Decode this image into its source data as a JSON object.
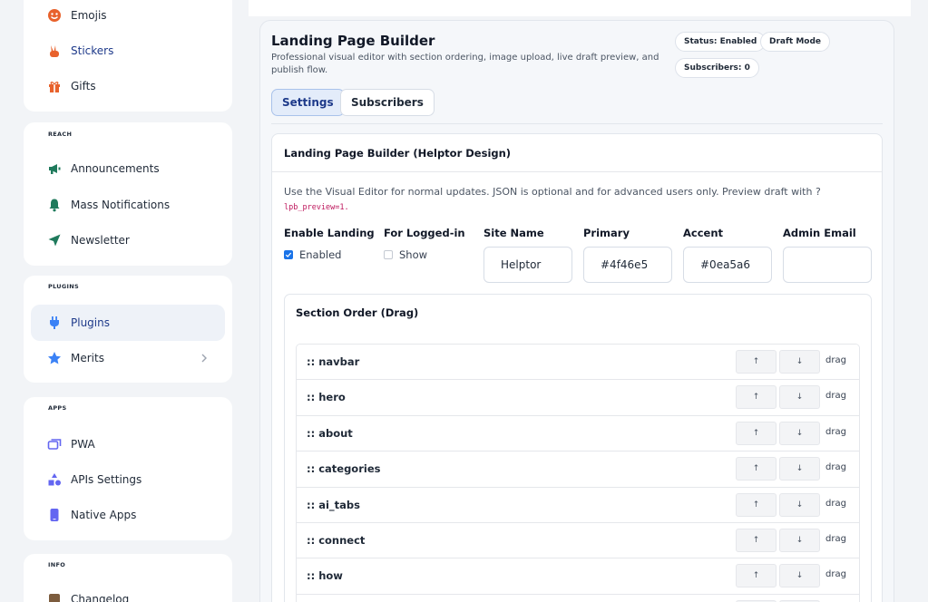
{
  "sidebar": {
    "sections": [
      {
        "title": "",
        "items": [
          {
            "label": "Emojis",
            "icon": "emoji-icon",
            "active": false
          },
          {
            "label": "Stickers",
            "icon": "sticker-icon",
            "active": false
          },
          {
            "label": "Gifts",
            "icon": "gift-icon",
            "active": false
          }
        ]
      },
      {
        "title": "REACH",
        "items": [
          {
            "label": "Announcements",
            "icon": "megaphone-icon"
          },
          {
            "label": "Mass Notifications",
            "icon": "bell-icon"
          },
          {
            "label": "Newsletter",
            "icon": "send-icon"
          }
        ]
      },
      {
        "title": "PLUGINS",
        "items": [
          {
            "label": "Plugins",
            "icon": "plug-icon",
            "active": true
          },
          {
            "label": "Merits",
            "icon": "star-icon",
            "expandable": true
          }
        ]
      },
      {
        "title": "APPS",
        "items": [
          {
            "label": "PWA",
            "icon": "windows-icon"
          },
          {
            "label": "APIs Settings",
            "icon": "shapes-icon"
          },
          {
            "label": "Native Apps",
            "icon": "phone-icon"
          }
        ]
      },
      {
        "title": "INFO",
        "items": [
          {
            "label": "Changelog",
            "icon": "changelog-icon"
          }
        ]
      }
    ]
  },
  "header": {
    "title": "Landing Page Builder",
    "description": "Professional visual editor with section ordering, image upload, live draft preview, and publish flow.",
    "badges": {
      "status": "Status: Enabled",
      "mode": "Draft Mode",
      "subscribers": "Subscribers: 0"
    }
  },
  "tabs": [
    {
      "label": "Settings",
      "active": true
    },
    {
      "label": "Subscribers",
      "active": false
    }
  ],
  "settings": {
    "title": "Landing Page Builder (Helptor Design)",
    "hint": "Use the Visual Editor for normal updates. JSON is optional and for advanced users only. Preview draft with ?",
    "hint_code": "lpb_preview=1.",
    "fields": {
      "enable_landing": {
        "label": "Enable Landing",
        "option": "Enabled",
        "checked": true
      },
      "for_logged_in": {
        "label": "For Logged-in",
        "option": "Show",
        "checked": false
      },
      "site_name": {
        "label": "Site Name",
        "value": "Helptor"
      },
      "primary": {
        "label": "Primary",
        "value": "#4f46e5"
      },
      "accent": {
        "label": "Accent",
        "value": "#0ea5a6"
      },
      "admin_email": {
        "label": "Admin Email",
        "value": ""
      }
    }
  },
  "section_order": {
    "title": "Section Order (Drag)",
    "up_label": "↑",
    "down_label": "↓",
    "drag_label": "drag",
    "items": [
      ":: navbar",
      ":: hero",
      ":: about",
      ":: categories",
      ":: ai_tabs",
      ":: connect",
      ":: how",
      ""
    ]
  },
  "colors": {
    "accent_blue": "#1a73e8",
    "active_bg": "#eef2f8",
    "icon_orange": "#e8622c",
    "icon_green": "#1f7a5c",
    "icon_blue": "#3b82f6",
    "icon_purple": "#6366f1"
  }
}
